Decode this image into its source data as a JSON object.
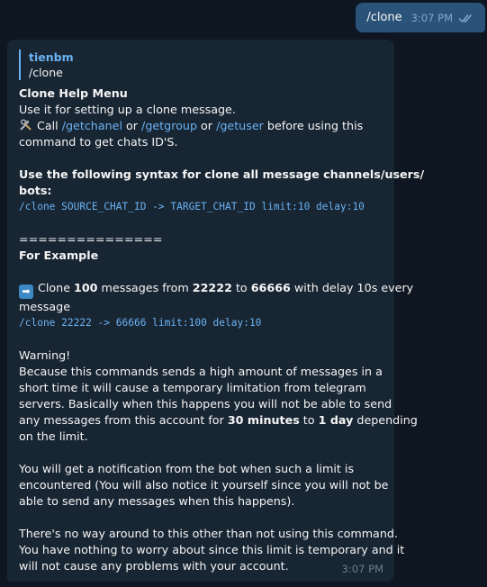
{
  "outgoing": {
    "text": "/clone",
    "time": "3:07 PM"
  },
  "incoming": {
    "reply_author": "tienbm",
    "reply_text": "/clone",
    "title": "Clone Help Menu",
    "intro": "Use it for setting up a clone message.",
    "call_prefix": "Call ",
    "link1": "/getchanel",
    "or1": " or ",
    "link2": "/getgroup",
    "or2": " or ",
    "link3": "/getuser",
    "call_suffix": " before using this",
    "call_line2": "command to get chats ID'S.",
    "syntax_heading_1": "Use the following syntax for clone all message channels/users/",
    "syntax_heading_2": "bots:",
    "syntax_code": "/clone SOURCE_CHAT_ID -> TARGET_CHAT_ID limit:10 delay:10",
    "divider": "===============",
    "example_heading": "For Example",
    "example_a": "Clone ",
    "example_b": "100",
    "example_c": " messages from ",
    "example_d": "22222",
    "example_e": " to ",
    "example_f": "66666",
    "example_g": " with delay 10s every",
    "example_line2": "message",
    "example_code": "/clone 22222 -> 66666 limit:100 delay:10",
    "warning_title": "Warning!",
    "warning_1": "Because this commands sends a high amount of messages in a",
    "warning_2": "short time it will cause a temporary limitation from telegram",
    "warning_3": "servers. Basically when this happens you will not be able to send",
    "warning_4a": "any messages from this account for ",
    "warning_4b": "30 minutes",
    "warning_4c": " to ",
    "warning_4d": "1 day",
    "warning_4e": " depending",
    "warning_5": "on the limit.",
    "notify_1": "You will get a notification from the bot when such a limit is",
    "notify_2": "encountered (You will also notice it yourself since you will not be",
    "notify_3": "able to send any messages when this happens).",
    "noway_1": "There's no way around to this other than not using this command.",
    "noway_2": "You have nothing to worry about since this limit is temporary and it",
    "noway_3": "will not cause any problems with your account.",
    "time": "3:07 PM"
  },
  "icons": {
    "tools": "hammer-wrench-icon",
    "arrow": "right-arrow-icon",
    "ticks": "double-check-icon"
  },
  "colors": {
    "background": "#0e1621",
    "outgoing_bubble": "#2b5278",
    "incoming_bubble": "#182533",
    "link": "#6ab2f2"
  }
}
